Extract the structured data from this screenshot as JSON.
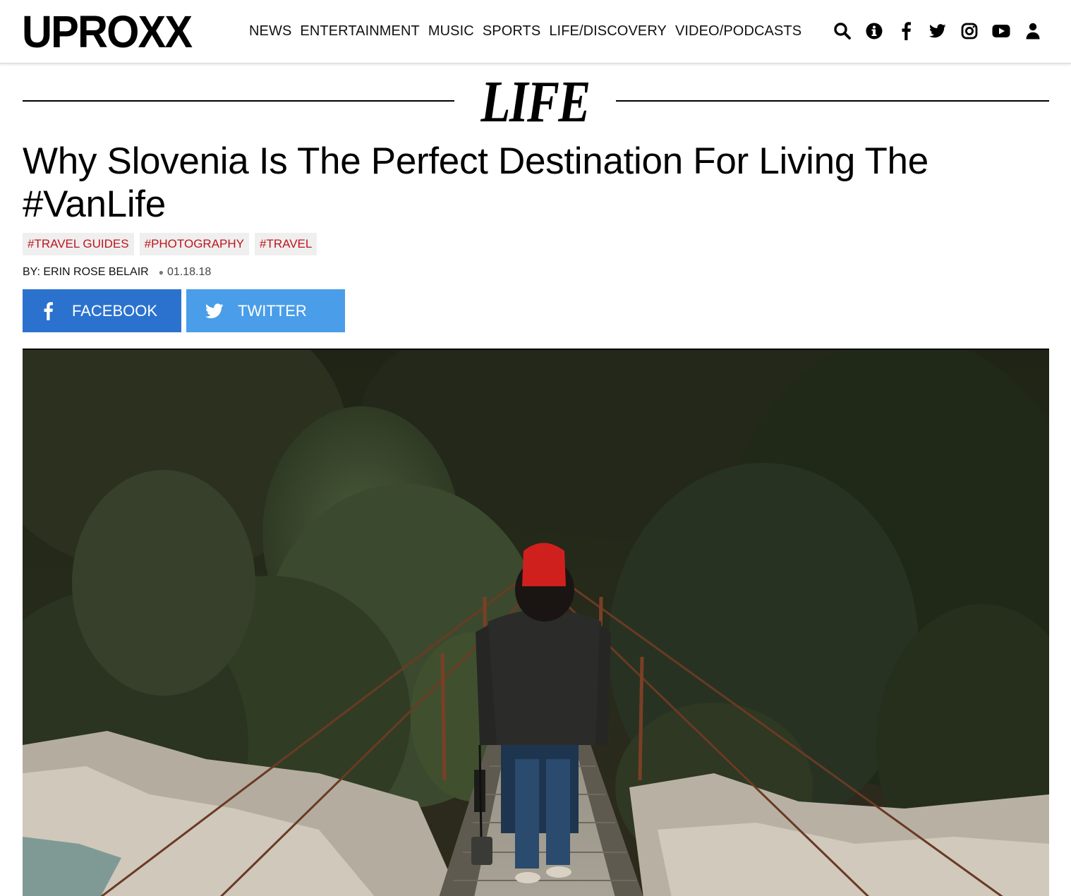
{
  "header": {
    "logo": "UPROXX",
    "nav": [
      "NEWS",
      "ENTERTAINMENT",
      "MUSIC",
      "SPORTS",
      "LIFE/DISCOVERY",
      "VIDEO/PODCASTS"
    ],
    "icons": [
      "search-icon",
      "info-icon",
      "facebook-icon",
      "twitter-icon",
      "instagram-icon",
      "youtube-icon",
      "user-icon"
    ]
  },
  "section": {
    "label": "LIFE"
  },
  "article": {
    "headline": "Why Slovenia Is The Perfect Destination For Living The #VanLife",
    "tags": [
      "#TRAVEL GUIDES",
      "#PHOTOGRAPHY",
      "#TRAVEL"
    ],
    "byline": "BY: ERIN ROSE BELAIR",
    "date": "01.18.18"
  },
  "share": {
    "facebook_label": "FACEBOOK",
    "twitter_label": "TWITTER"
  },
  "colors": {
    "tag_text": "#c0141b",
    "tag_bg": "#efefef",
    "facebook": "#2b72cf",
    "twitter": "#4a9de8"
  }
}
